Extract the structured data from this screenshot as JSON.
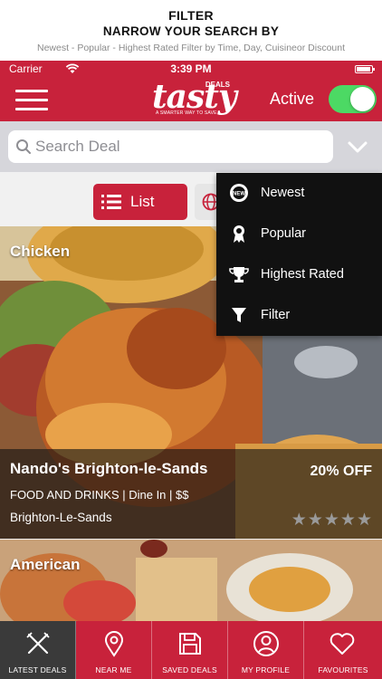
{
  "promo": {
    "title": "FILTER",
    "subtitle": "NARROW YOUR SEARCH BY",
    "description": "Newest - Popular - Highest Rated Filter by Time, Day, Cuisineor Discount"
  },
  "status_bar": {
    "carrier": "Carrier",
    "time": "3:39 PM"
  },
  "header": {
    "logo_text": "tasty",
    "logo_badge": "DEALS",
    "logo_tagline": "A SMARTER WAY TO SAVE",
    "active_label": "Active",
    "active_on": true
  },
  "search": {
    "placeholder": "Search Deal",
    "value": ""
  },
  "view_toggle": {
    "list_label": "List"
  },
  "dropdown": {
    "items": [
      {
        "label": "Newest",
        "icon": "new-badge-icon"
      },
      {
        "label": "Popular",
        "icon": "award-ribbon-icon"
      },
      {
        "label": "Highest Rated",
        "icon": "trophy-icon"
      },
      {
        "label": "Filter",
        "icon": "funnel-icon"
      }
    ]
  },
  "deals": [
    {
      "category": "Chicken",
      "name": "Nando's Brighton-le-Sands",
      "discount": "20% OFF",
      "meta": "FOOD AND DRINKS | Dine In | $$",
      "location": "Brighton-Le-Sands",
      "rating": 0
    },
    {
      "category": "American"
    }
  ],
  "tabs": [
    {
      "label": "LATEST DEALS",
      "icon": "fork-knife-icon",
      "active": true
    },
    {
      "label": "NEAR ME",
      "icon": "location-pin-icon",
      "active": false
    },
    {
      "label": "SAVED DEALS",
      "icon": "floppy-disk-icon",
      "active": false
    },
    {
      "label": "MY PROFILE",
      "icon": "user-icon",
      "active": false
    },
    {
      "label": "FAVOURITES",
      "icon": "heart-icon",
      "active": false
    }
  ],
  "colors": {
    "brand": "#c8223b",
    "toggle_on": "#4cd964",
    "dropdown_bg": "#111111",
    "tab_active": "#3a3a3a"
  }
}
